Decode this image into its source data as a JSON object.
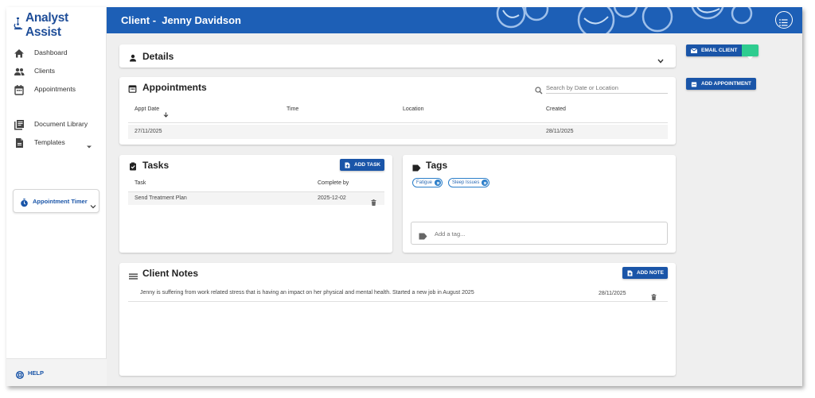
{
  "app": {
    "name": "Analyst Assist",
    "logo_icon": "microscope-icon"
  },
  "sidebar": {
    "items": [
      {
        "label": "Dashboard",
        "icon": "home-icon"
      },
      {
        "label": "Clients",
        "icon": "people-icon"
      },
      {
        "label": "Appointments",
        "icon": "calendar-icon"
      },
      {
        "label": "Document Library",
        "icon": "library-icon"
      },
      {
        "label": "Templates",
        "icon": "document-icon"
      }
    ],
    "timer_label": "Appointment Timer",
    "help_label": "HELP"
  },
  "header": {
    "title": "Client -  Jenny Davidson"
  },
  "details": {
    "title": "Details"
  },
  "appointments": {
    "title": "Appointments",
    "search_placeholder": "Search by Date or Location",
    "columns": [
      "Appt Date",
      "Time",
      "Location",
      "Created"
    ],
    "rows": [
      {
        "date": "27/11/2025",
        "time": "",
        "location": "",
        "created": "28/11/2025"
      }
    ]
  },
  "tasks": {
    "title": "Tasks",
    "add_label": "ADD TASK",
    "columns": [
      "Task",
      "Complete by"
    ],
    "rows": [
      {
        "task": "Send Treatment Plan",
        "complete_by": "2025-12-02"
      }
    ]
  },
  "tags": {
    "title": "Tags",
    "items": [
      "Fatigue",
      "Sleep Issues"
    ],
    "input_placeholder": "Add a tag..."
  },
  "notes": {
    "title": "Client Notes",
    "add_label": "ADD NOTE",
    "rows": [
      {
        "text": "Jenny is suffering from work related stress that is having an impact on her physical and mental health. Started a new job in August 2025",
        "date": "28/11/2025"
      }
    ]
  },
  "actions": {
    "email_label": "EMAIL CLIENT",
    "add_appointment_label": "ADD APPOINTMENT"
  },
  "colors": {
    "primary": "#1d5fb6",
    "accent_green": "#2ecc8f",
    "button_blue": "#1a55a8"
  }
}
